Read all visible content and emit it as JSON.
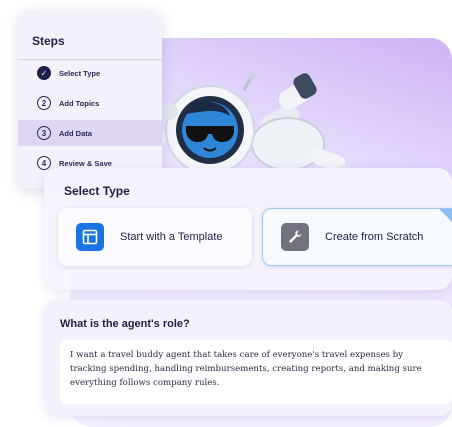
{
  "steps": {
    "title": "Steps",
    "items": [
      {
        "num": "✓",
        "label": "Select Type",
        "state": "completed"
      },
      {
        "num": "2",
        "label": "Add Topics",
        "state": "pending"
      },
      {
        "num": "3",
        "label": "Add Data",
        "state": "current"
      },
      {
        "num": "4",
        "label": "Review & Save",
        "state": "pending"
      }
    ]
  },
  "select_type": {
    "title": "Select Type",
    "options": [
      {
        "label": "Start with a Template",
        "icon": "template-icon",
        "selected": false
      },
      {
        "label": "Create from Scratch",
        "icon": "wrench-icon",
        "selected": true
      }
    ],
    "selected_check": "✓"
  },
  "role": {
    "title": "What is the agent's role?",
    "text": "I want a travel buddy agent that takes care of everyone's travel expenses by tracking spending, handling reimbursements, creating reports, and making sure everything follows company rules."
  },
  "colors": {
    "accent_blue": "#1b74e4",
    "step_done": "#1e1f4b",
    "hero_gradient_top": "#cdb4f4",
    "panel_bg": "#f4f0fd"
  }
}
